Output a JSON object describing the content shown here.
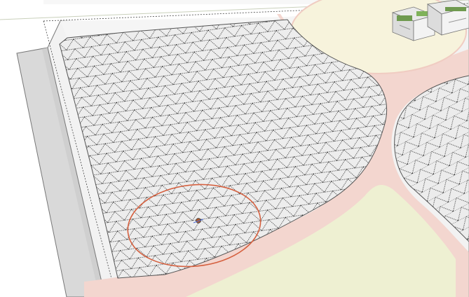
{
  "viewport": {
    "kind": "3d-modeling-viewport",
    "tool_active": "circle-tool",
    "selected_object": "circle-outline",
    "visible_text": []
  },
  "scene": {
    "objects": [
      "ground-slab",
      "grass-strip",
      "triangulated-terrain-mesh-left",
      "triangulated-terrain-mesh-right",
      "curved-path",
      "plaza-area",
      "lawn-area",
      "buildings-cluster",
      "circle-outline",
      "cursor-marker"
    ]
  },
  "colors": {
    "background": "#ffffff",
    "ground_side": "#d9d9d9",
    "ground_top": "#f2f2f2",
    "path": "#f3d6cf",
    "plaza": "#f7f3dc",
    "lawn": "#eef0d2",
    "mesh_fill": "#ededed",
    "mesh_line": "#333333",
    "circle": "#d5603f",
    "building_roof": "#6f9a4f"
  }
}
